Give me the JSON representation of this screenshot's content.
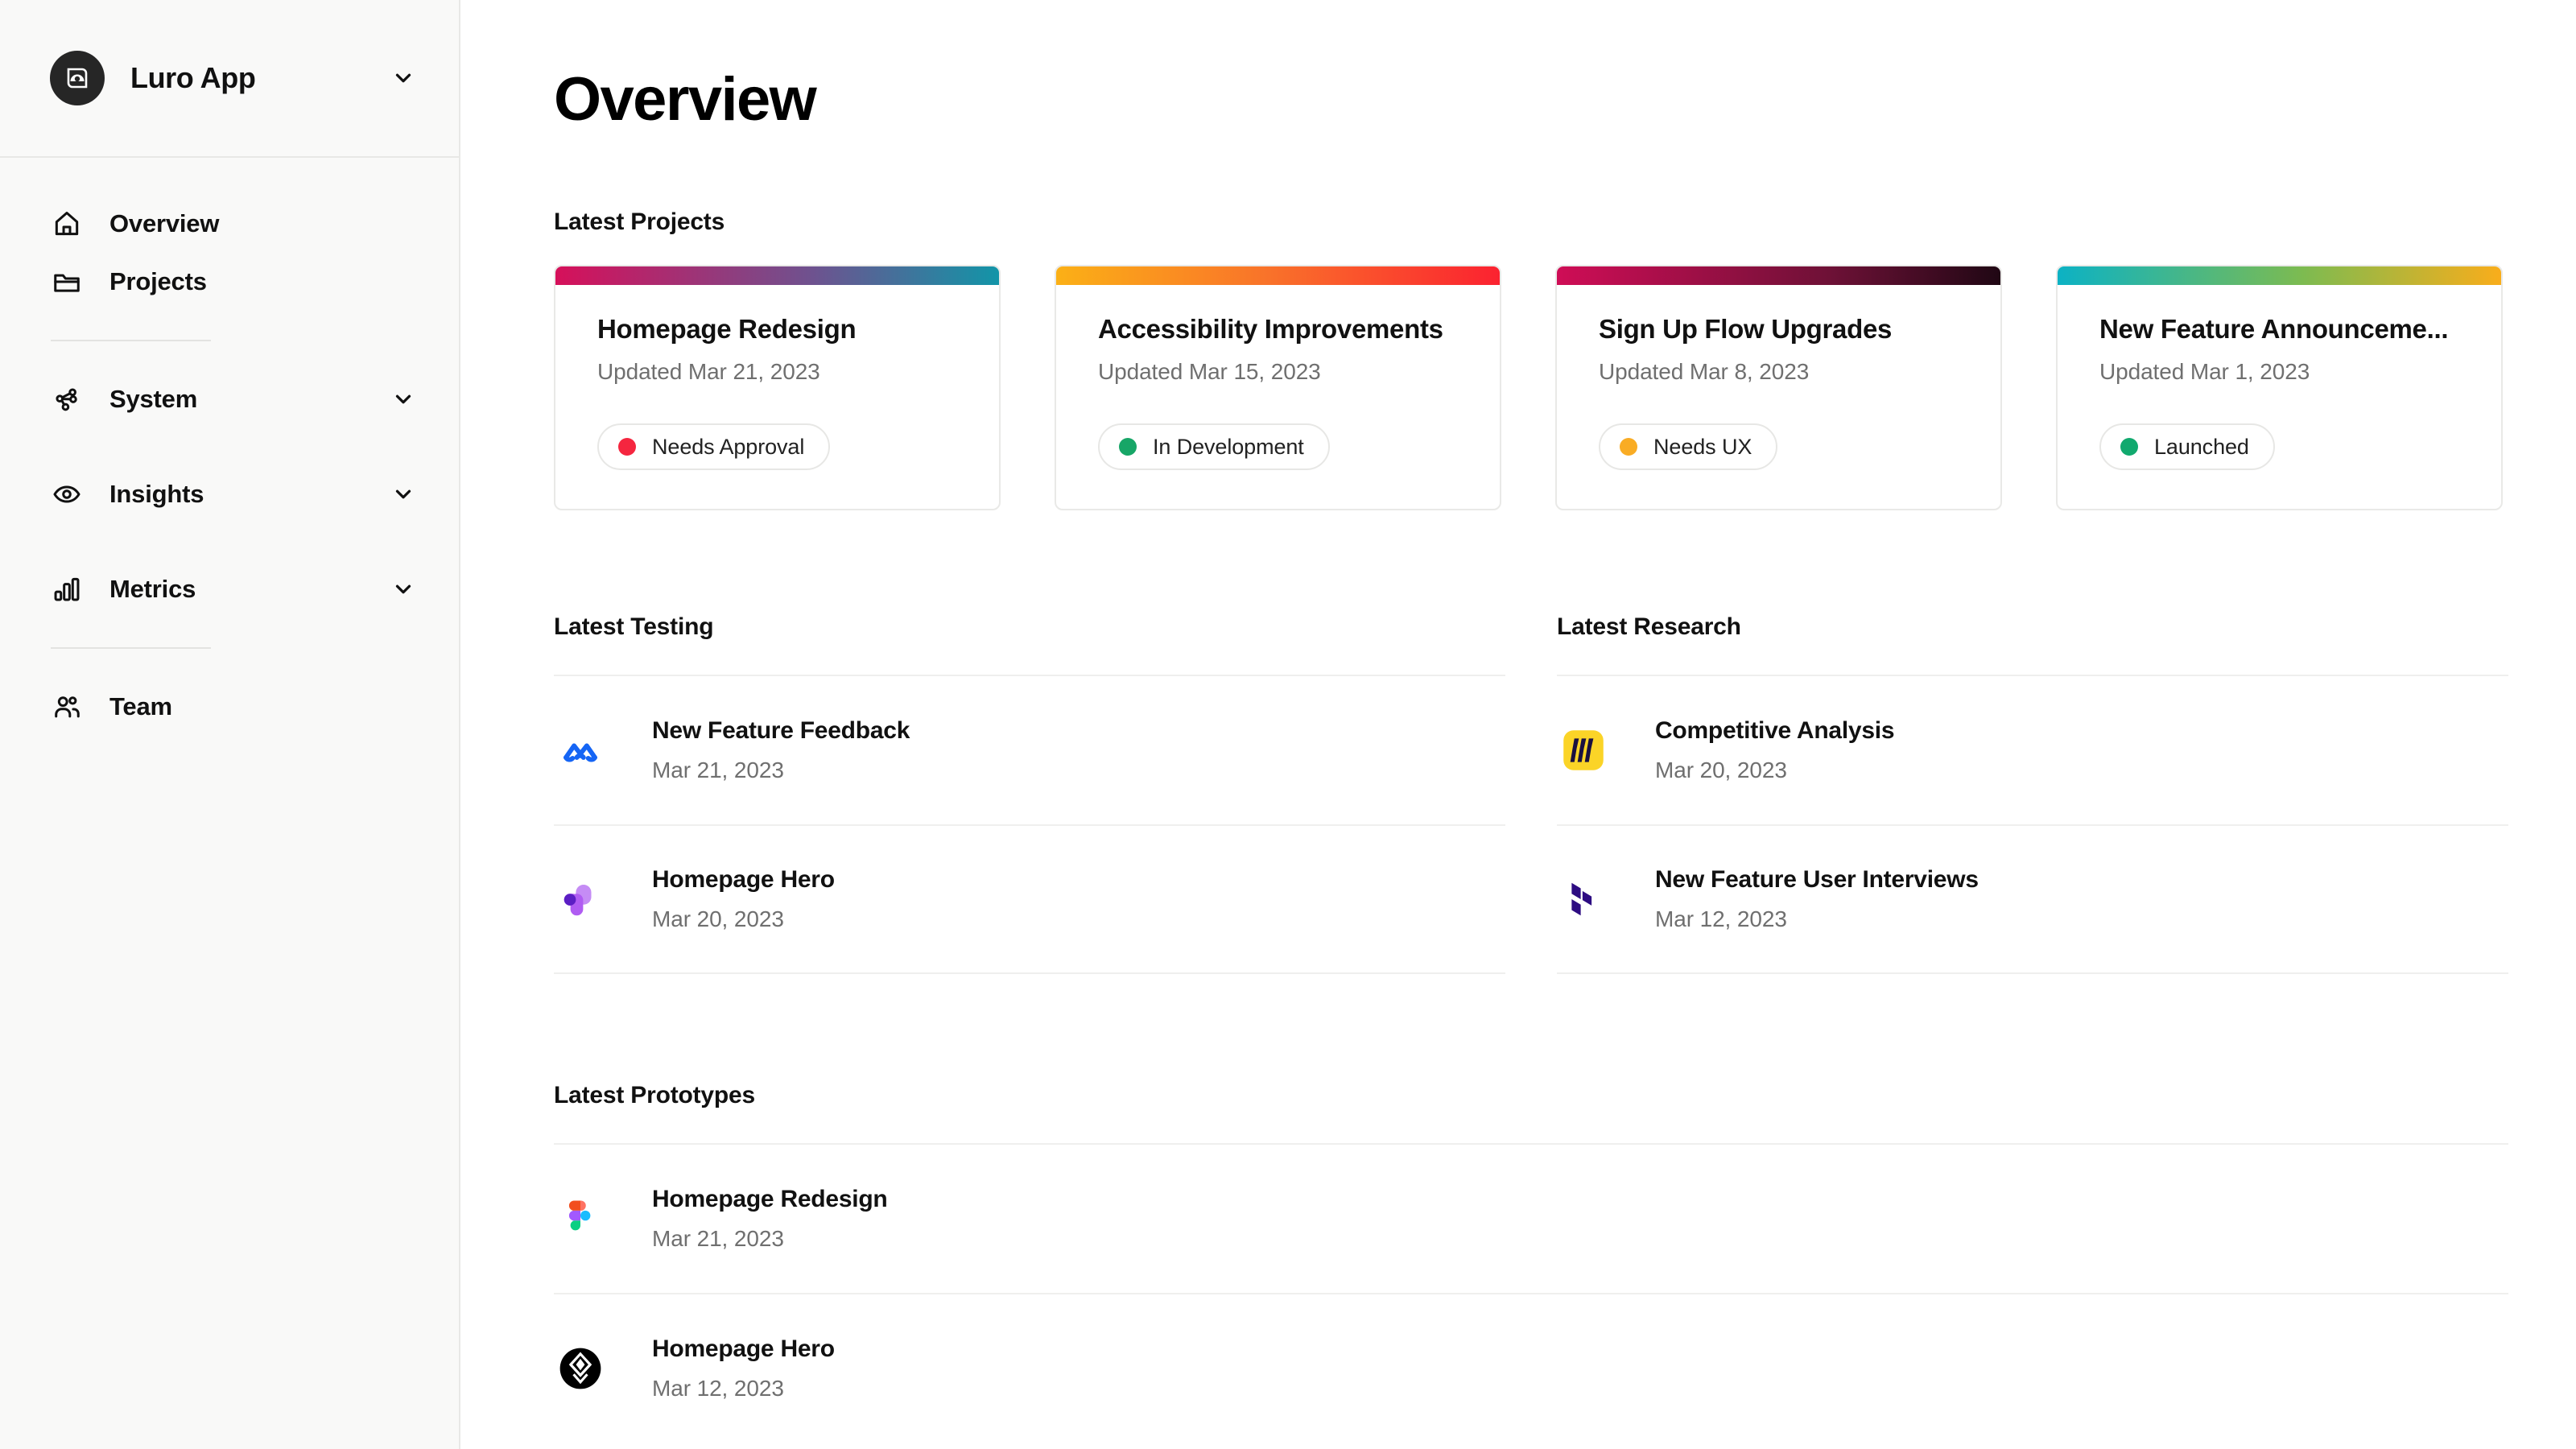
{
  "sidebar": {
    "brand": {
      "name": "Luro App",
      "logo_icon": "luro-logo-icon",
      "caret_icon": "chevron-down-icon"
    },
    "items": [
      {
        "label": "Overview",
        "icon": "home-icon",
        "expandable": false
      },
      {
        "label": "Projects",
        "icon": "folder-icon",
        "expandable": false
      },
      {
        "label": "System",
        "icon": "nodes-icon",
        "expandable": true
      },
      {
        "label": "Insights",
        "icon": "eye-icon",
        "expandable": true
      },
      {
        "label": "Metrics",
        "icon": "bar-chart-icon",
        "expandable": true
      },
      {
        "label": "Team",
        "icon": "users-icon",
        "expandable": false
      }
    ]
  },
  "main": {
    "page_title": "Overview",
    "sections": {
      "latest_projects": "Latest Projects",
      "latest_testing": "Latest Testing",
      "latest_research": "Latest Research",
      "latest_prototypes": "Latest Prototypes"
    }
  },
  "projects": [
    {
      "title": "Homepage Redesign",
      "updated": "Updated Mar 21, 2023",
      "status": "Needs Approval",
      "status_color": "#f5263f",
      "gradient_from": "#d6105a",
      "gradient_mid": "#6e528f",
      "gradient_to": "#1295a8"
    },
    {
      "title": "Accessibility Improvements",
      "updated": "Updated Mar 15, 2023",
      "status": "In Development",
      "status_color": "#17a667",
      "gradient_from": "#fbb016",
      "gradient_mid": "#f9722a",
      "gradient_to": "#fb2230"
    },
    {
      "title": "Sign Up Flow Upgrades",
      "updated": "Updated Mar 8, 2023",
      "status": "Needs UX",
      "status_color": "#f9ac24",
      "gradient_from": "#cf0d56",
      "gradient_mid": "#6d1136",
      "gradient_to": "#200714"
    },
    {
      "title": "New Feature Announceme...",
      "updated": "Updated Mar 1, 2023",
      "status": "Launched",
      "status_color": "#11a96e",
      "gradient_from": "#0cb2c4",
      "gradient_mid": "#7cbb51",
      "gradient_to": "#f9ad1b"
    }
  ],
  "testing": [
    {
      "title": "New Feature Feedback",
      "date": "Mar 21, 2023",
      "icon": "maze-icon"
    },
    {
      "title": "Homepage Hero",
      "date": "Mar 20, 2023",
      "icon": "usertesting-icon"
    }
  ],
  "research": [
    {
      "title": "Competitive Analysis",
      "date": "Mar 20, 2023",
      "icon": "miro-icon"
    },
    {
      "title": "New Feature User Interviews",
      "date": "Mar 12, 2023",
      "icon": "dovetail-icon"
    }
  ],
  "prototypes": [
    {
      "title": "Homepage Redesign",
      "date": "Mar 21, 2023",
      "icon": "figma-icon"
    },
    {
      "title": "Homepage Hero",
      "date": "Mar 12, 2023",
      "icon": "framer-icon"
    }
  ]
}
